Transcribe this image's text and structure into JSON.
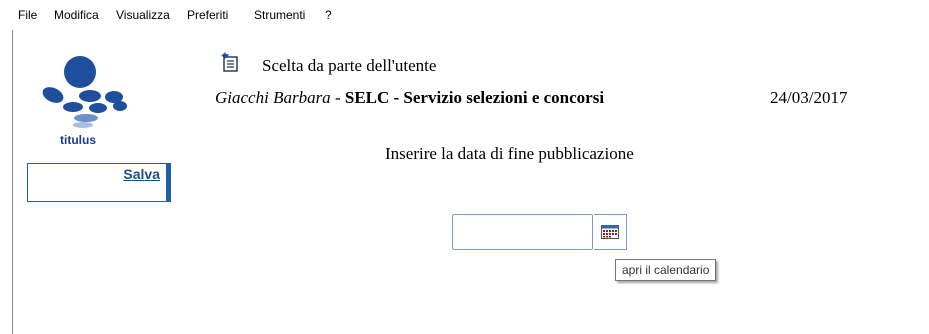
{
  "menu": {
    "items": [
      "File",
      "Modifica",
      "Visualizza",
      "Preferiti",
      "Strumenti",
      "?"
    ]
  },
  "sidebar": {
    "logo_text": "titulus",
    "save_label": "Salva"
  },
  "header": {
    "title": "Scelta da parte dell'utente",
    "user_name": "Giacchi Barbara",
    "separator": " - ",
    "office": "SELC - Servizio selezioni e concorsi",
    "date": "24/03/2017"
  },
  "form": {
    "instruction": "Inserire la data di fine pubblicazione",
    "date_value": "",
    "calendar_tooltip": "apri il calendario"
  },
  "colors": {
    "logo_blue": "#1f4f9c",
    "link_blue": "#1a4f8a",
    "box_border": "#1f5fa3"
  }
}
